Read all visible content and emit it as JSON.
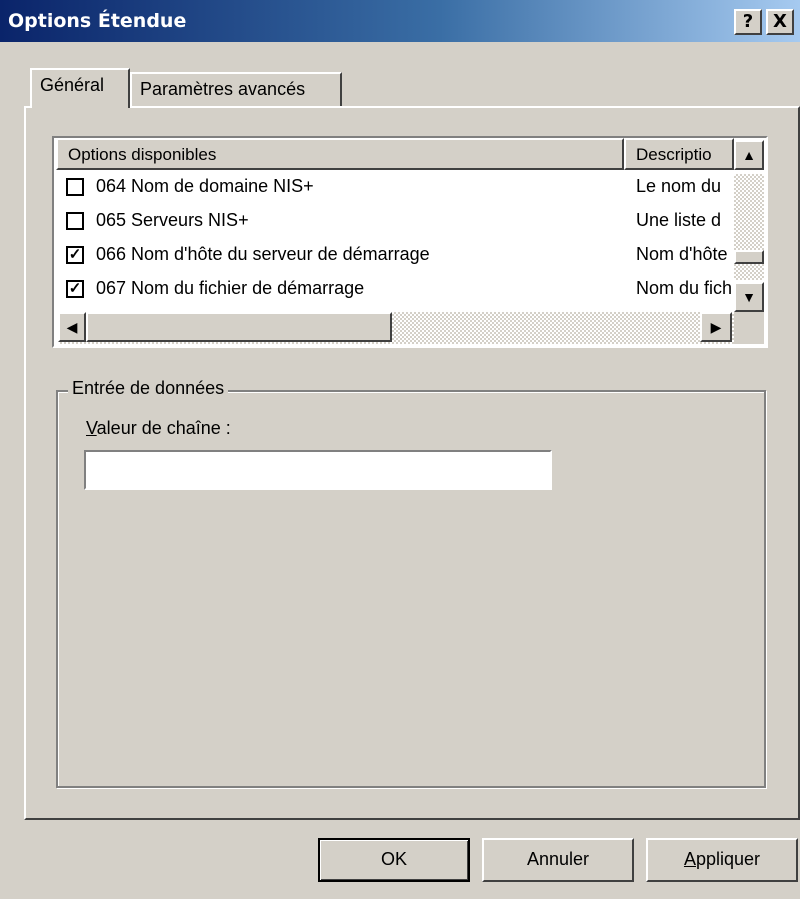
{
  "window": {
    "title": "Options Étendue",
    "help_button": "?",
    "close_button": "X"
  },
  "tabs": [
    {
      "label": "Général",
      "active": true
    },
    {
      "label": "Paramètres avancés",
      "active": false
    }
  ],
  "options_list": {
    "columns": [
      "Options disponibles",
      "Descriptio"
    ],
    "rows": [
      {
        "checked": false,
        "name": "064 Nom de domaine NIS+",
        "description": "Le nom du"
      },
      {
        "checked": false,
        "name": "065 Serveurs NIS+",
        "description": "Une liste d"
      },
      {
        "checked": true,
        "name": "066 Nom d'hôte du serveur de démarrage",
        "description": "Nom d'hôte"
      },
      {
        "checked": true,
        "name": "067 Nom du fichier de démarrage",
        "description": "Nom du fichier"
      }
    ]
  },
  "data_entry": {
    "group_label": "Entrée de données",
    "field_label_mnemonic": "V",
    "field_label_rest": "aleur de chaîne :",
    "value": ""
  },
  "buttons": {
    "ok": "OK",
    "cancel": "Annuler",
    "apply_mnemonic": "A",
    "apply_rest": "ppliquer"
  }
}
